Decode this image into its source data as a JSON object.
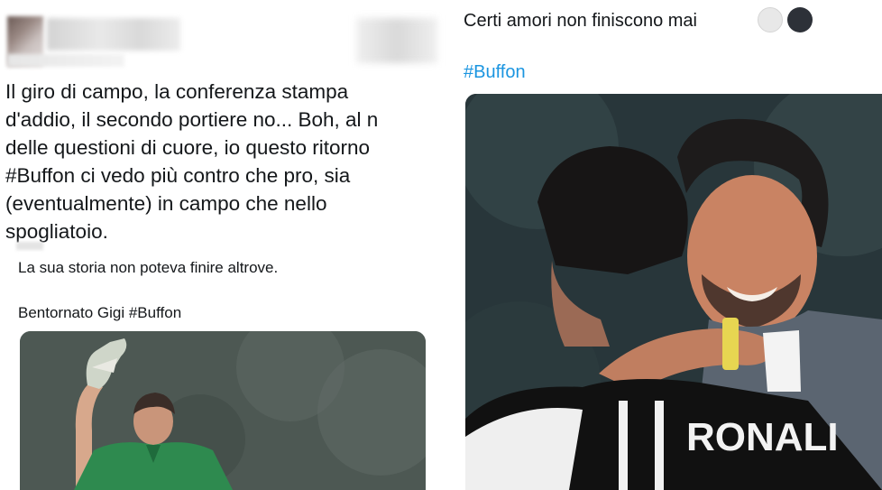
{
  "left_tweet": {
    "text": "Il giro di campo, la conferenza stampa\nd'addio, il secondo portiere no... Boh, al n\ndelle questioni di cuore, io questo ritorno\n#Buffon ci vedo più contro che pro, sia\n(eventualmente) in campo che nello\nspogliatoio.",
    "quoted": {
      "line1": "La sua storia non poteva finire altrove.",
      "line2": "Bentornato Gigi #Buffon"
    }
  },
  "right_tweet": {
    "line1": "Certi amori non finiscono mai",
    "hashtag": "#Buffon",
    "jersey_text": "RONALI"
  },
  "colors": {
    "hashtag": "#1b95e0",
    "text": "#14171a"
  },
  "icons": [
    "white-circle-emoji",
    "black-circle-emoji"
  ]
}
